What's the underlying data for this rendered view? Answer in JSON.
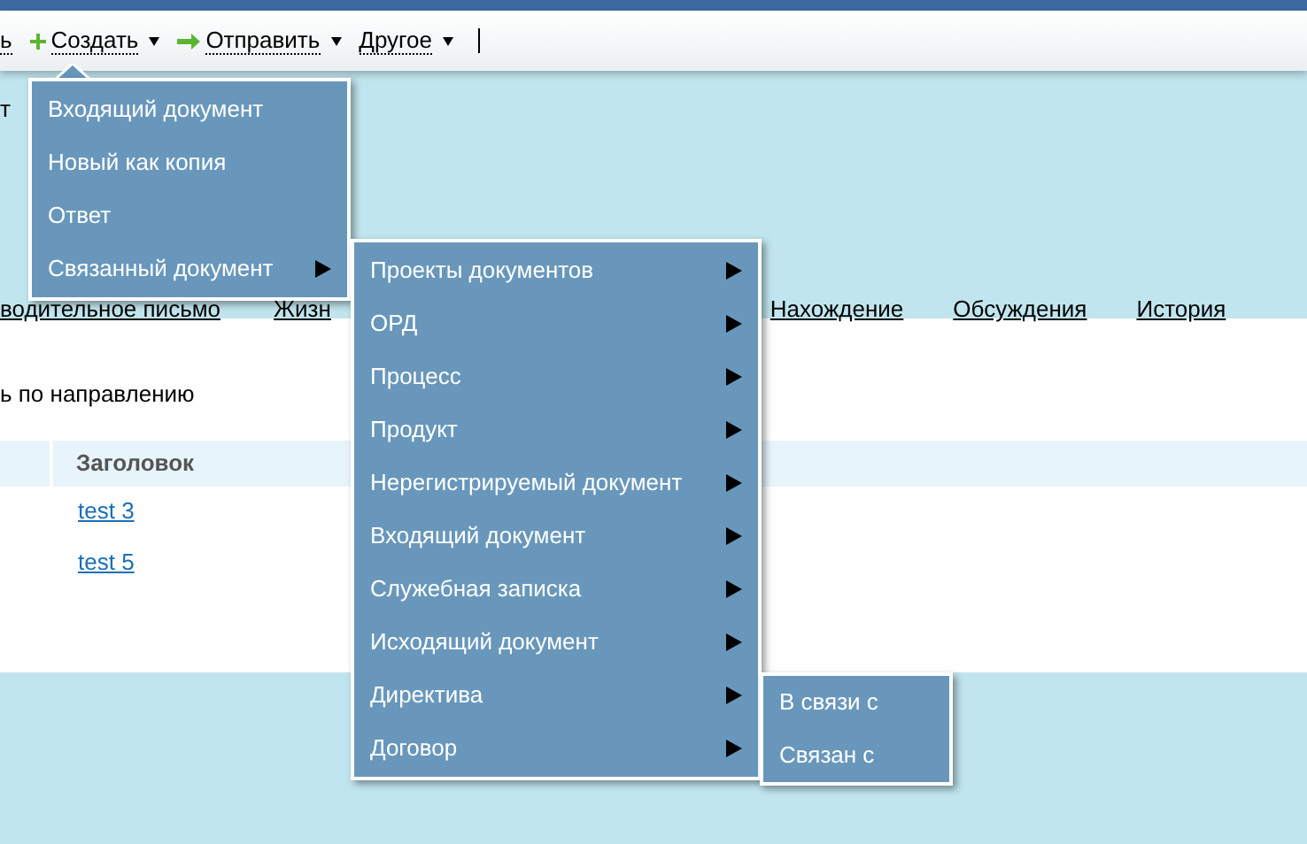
{
  "toolbar": {
    "items": [
      {
        "label": "ь",
        "kind": "plain",
        "dropdown": false
      },
      {
        "label": "Создать",
        "kind": "plus",
        "dropdown": true
      },
      {
        "label": "Отправить",
        "kind": "arrow",
        "dropdown": true
      },
      {
        "label": "Другое",
        "kind": "plain",
        "dropdown": true
      }
    ]
  },
  "header_fragment": "т",
  "tabs": [
    {
      "label": "водительное письмо"
    },
    {
      "label": "Жизн"
    },
    {
      "label": "Нахождение"
    },
    {
      "label": "Обсуждения"
    },
    {
      "label": "История"
    }
  ],
  "section_label": "ь по направлению",
  "table": {
    "columns": [
      "Заголовок"
    ],
    "rows": [
      [
        "test 3"
      ],
      [
        "test 5"
      ]
    ]
  },
  "create_menu": [
    {
      "label": "Входящий документ",
      "submenu": false
    },
    {
      "label": "Новый как копия",
      "submenu": false
    },
    {
      "label": "Ответ",
      "submenu": false
    },
    {
      "label": "Связанный документ",
      "submenu": true
    }
  ],
  "related_menu": [
    {
      "label": "Проекты документов",
      "submenu": true
    },
    {
      "label": "ОРД",
      "submenu": true
    },
    {
      "label": "Процесс",
      "submenu": true
    },
    {
      "label": "Продукт",
      "submenu": true
    },
    {
      "label": "Нерегистрируемый документ",
      "submenu": true
    },
    {
      "label": "Входящий документ",
      "submenu": true
    },
    {
      "label": "Служебная записка",
      "submenu": true
    },
    {
      "label": "Исходящий документ",
      "submenu": true
    },
    {
      "label": "Директива",
      "submenu": true
    },
    {
      "label": "Договор",
      "submenu": true
    }
  ],
  "directive_menu": [
    {
      "label": "В связи с",
      "submenu": false
    },
    {
      "label": "Связан с",
      "submenu": false
    }
  ]
}
